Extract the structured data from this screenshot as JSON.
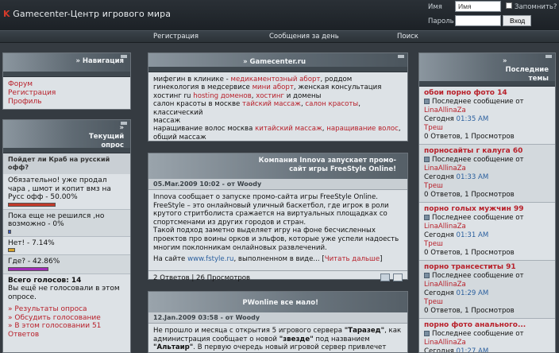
{
  "header": {
    "logo_mark": "K",
    "title": "Gamecenter-Центр игрового мира",
    "login": {
      "name_label": "Имя",
      "name_value": "Имя",
      "password_label": "Пароль",
      "remember_label": "Запомнить?",
      "submit_label": "Вход"
    }
  },
  "nav": {
    "items": [
      "Регистрация",
      "Сообщения за день",
      "Поиск"
    ]
  },
  "left": {
    "nav_block": {
      "title": "» Навигация",
      "links": [
        "Форум",
        "Регистрация",
        "Профиль"
      ]
    },
    "poll": {
      "title": "» Текущий опрос",
      "question": "Пойдет ли Краб на русский офф?",
      "options": [
        {
          "text": "Обязательно! уже продал чара , шмот и копит вмз на Русс офф - 50.00%",
          "percent": 50.0,
          "color": "#c23a2a"
        },
        {
          "text": "Пока еще не решился ,но возможно - 0%",
          "percent": 0,
          "color": "#3a5cc2"
        },
        {
          "text": "Нет! - 7.14%",
          "percent": 7.14,
          "color": "#d6a22a"
        },
        {
          "text": "Где? - 42.86%",
          "percent": 42.86,
          "color": "#a02ab8"
        }
      ],
      "total": "Всего голосов: 14",
      "not_voted": "Вы ещё не голосовали в этом опросе.",
      "links": [
        "» Результаты опроса",
        "» Обсудить голосование",
        "» В этом голосовании 51 Ответов"
      ]
    }
  },
  "center": {
    "ads": {
      "title": "» Gamecenter.ru",
      "lines": [
        [
          {
            "t": "мифегин в клинике - "
          },
          {
            "t": "медикаментозный аборт",
            "l": 1
          },
          {
            "t": ", роддом"
          }
        ],
        [
          {
            "t": "гинекология в медсервисе "
          },
          {
            "t": "мини аборт",
            "l": 1
          },
          {
            "t": ", женская консультация"
          }
        ],
        [
          {
            "t": "хостинг ru "
          },
          {
            "t": "hosting доменов",
            "l": 1
          },
          {
            "t": ", "
          },
          {
            "t": "хостинг",
            "l": 1
          },
          {
            "t": " и домены"
          }
        ],
        [
          {
            "t": "салон красоты в москве "
          },
          {
            "t": "тайский массаж",
            "l": 1
          },
          {
            "t": ", "
          },
          {
            "t": "салон красоты",
            "l": 1
          },
          {
            "t": ", классический"
          }
        ],
        [
          {
            "t": "массаж"
          }
        ],
        [
          {
            "t": "наращивание волос москва "
          },
          {
            "t": "китайский массаж",
            "l": 1
          },
          {
            "t": ", "
          },
          {
            "t": "наращивание волос",
            "l": 1
          },
          {
            "t": ","
          }
        ],
        [
          {
            "t": "общий массаж"
          }
        ]
      ]
    },
    "news1": {
      "title_line1": "Компания Innova запускает промо-",
      "title_line2": "сайт игры FreeStyle Online!",
      "date": "05.Mar.2009 10:02 - от Woody",
      "text_lines": [
        "Innova сообщает о запуске промо-сайта игры FreeStyle Online.",
        "FreeStyle – это онлайновый уличный баскетбол, где игрок в роли",
        "крутого стритболиста сражается на виртуальных площадках со",
        "спортсменами из других городов и стран.",
        "Такой подход заметно выделяет игру на фоне бесчисленных",
        "проектов про воины орков и эльфов, которые уже успели надоесть",
        "многим поклонникам онлайновых развлечений."
      ],
      "last_prefix": "На сайте ",
      "site_link": "www.fstyle.ru",
      "last_middle": ", выполненном в виде... [",
      "read_more": "Читать дальше",
      "last_suffix": "]",
      "footer": "2 Ответов | 26 Просмотров"
    },
    "news2": {
      "title": "PWonline все мало!",
      "date": "12.Jan.2009 03:58 - от Woody",
      "line1_pre": "Не прошло и месяца с открытия 5 игрового сервера ",
      "line1_bold": "\"Таразед\"",
      "line1_post": ", как",
      "line2_pre": "администрация сообщает о новой ",
      "line2_q": "\"звезде\"",
      "line2_post": " под названием",
      "line3_bold": "\"Альтаир\"",
      "line3_post": ". В первую очередь новый игровой сервер привлечет"
    }
  },
  "right": {
    "title_line1": "»",
    "title_line2": "Последние темы",
    "topics": [
      {
        "title": "обои порно фото 14",
        "last": "Последнее сообщение от",
        "user": "LinaAllinaZa",
        "day": "Сегодня",
        "time": "01:35 AM",
        "author": "Треш",
        "stats": "0 Ответов, 1 Просмотров"
      },
      {
        "title": "порносайты г калуга 60",
        "last": "Последнее сообщение от",
        "user": "LinaAllinaZa",
        "day": "Сегодня",
        "time": "01:33 AM",
        "author": "Треш",
        "stats": "0 Ответов, 1 Просмотров"
      },
      {
        "title": "порно голых мужчин 99",
        "last": "Последнее сообщение от",
        "user": "LinaAllinaZa",
        "day": "Сегодня",
        "time": "01:31 AM",
        "author": "Треш",
        "stats": "0 Ответов, 1 Просмотров"
      },
      {
        "title": "порно трансеститы 91",
        "last": "Последнее сообщение от",
        "user": "LinaAllinaZa",
        "day": "Сегодня",
        "time": "01:29 AM",
        "author": "Треш",
        "stats": "0 Ответов, 1 Просмотров"
      },
      {
        "title": "порно фото анального...",
        "last": "Последнее сообщение от",
        "user": "LinaAllinaZa",
        "day": "Сегодня",
        "time": "01:27 AM",
        "author": "",
        "stats": ""
      }
    ]
  }
}
